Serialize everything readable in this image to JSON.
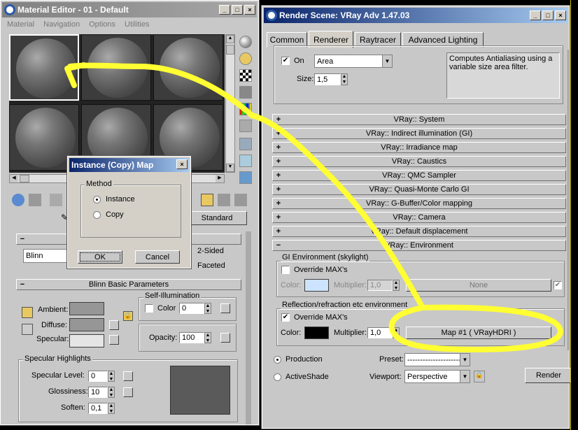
{
  "material_editor": {
    "title": "Material Editor - 01 - Default",
    "menu": [
      "Material",
      "Navigation",
      "Options",
      "Utilities"
    ],
    "material_name_partial": "Standard",
    "shader": "Blinn",
    "two_sided": "2-Sided",
    "faceted": "Faceted",
    "blinn_params_title": "Blinn Basic Parameters",
    "ambient": "Ambient:",
    "diffuse": "Diffuse:",
    "specular": "Specular:",
    "self_illum": "Self-Illumination",
    "color_label": "Color",
    "color_value": "0",
    "opacity_label": "Opacity:",
    "opacity_value": "100",
    "spec_highlights": "Specular Highlights",
    "spec_level_label": "Specular Level:",
    "spec_level_value": "0",
    "glossiness_label": "Glossiness:",
    "glossiness_value": "10",
    "soften_label": "Soften:",
    "soften_value": "0,1"
  },
  "dialog": {
    "title": "Instance (Copy) Map",
    "group": "Method",
    "opt_instance": "Instance",
    "opt_copy": "Copy",
    "ok": "OK",
    "cancel": "Cancel"
  },
  "render": {
    "title": "Render Scene: VRay Adv 1.47.03",
    "tabs": [
      "Common",
      "Renderer",
      "Raytracer",
      "Advanced Lighting"
    ],
    "aa_on": "On",
    "aa_filter": "Area",
    "aa_size_label": "Size:",
    "aa_size": "1,5",
    "aa_desc": "Computes Antialiasing using a variable size area filter.",
    "rollouts": [
      "VRay:: System",
      "VRay:: Indirect illumination (GI)",
      "VRay:: Irradiance map",
      "VRay:: Caustics",
      "VRay:: QMC Sampler",
      "VRay:: Quasi-Monte Carlo GI",
      "VRay:: G-Buffer/Color mapping",
      "VRay:: Camera",
      "VRay:: Default displacement"
    ],
    "env_rollout": "VRay:: Environment",
    "gi_env_group": "GI Environment (skylight)",
    "override": "Override MAX's",
    "color_label": "Color:",
    "multiplier_label": "Multiplier:",
    "gi_mult": "1,0",
    "gi_map": "None",
    "refl_group": "Reflection/refraction etc environment",
    "refl_mult": "1,0",
    "refl_map": "Map #1  ( VRayHDRI )",
    "production": "Production",
    "activeshade": "ActiveShade",
    "preset_label": "Preset:",
    "preset_value": "----------------------",
    "viewport_label": "Viewport:",
    "viewport_value": "Perspective",
    "render_btn": "Render"
  },
  "colors": {
    "window_bg": "#c8c8c8",
    "title_active": "#0a246a",
    "annotation": "#ffff33",
    "gi_color": "#cce4ff",
    "refl_color": "#000000"
  }
}
